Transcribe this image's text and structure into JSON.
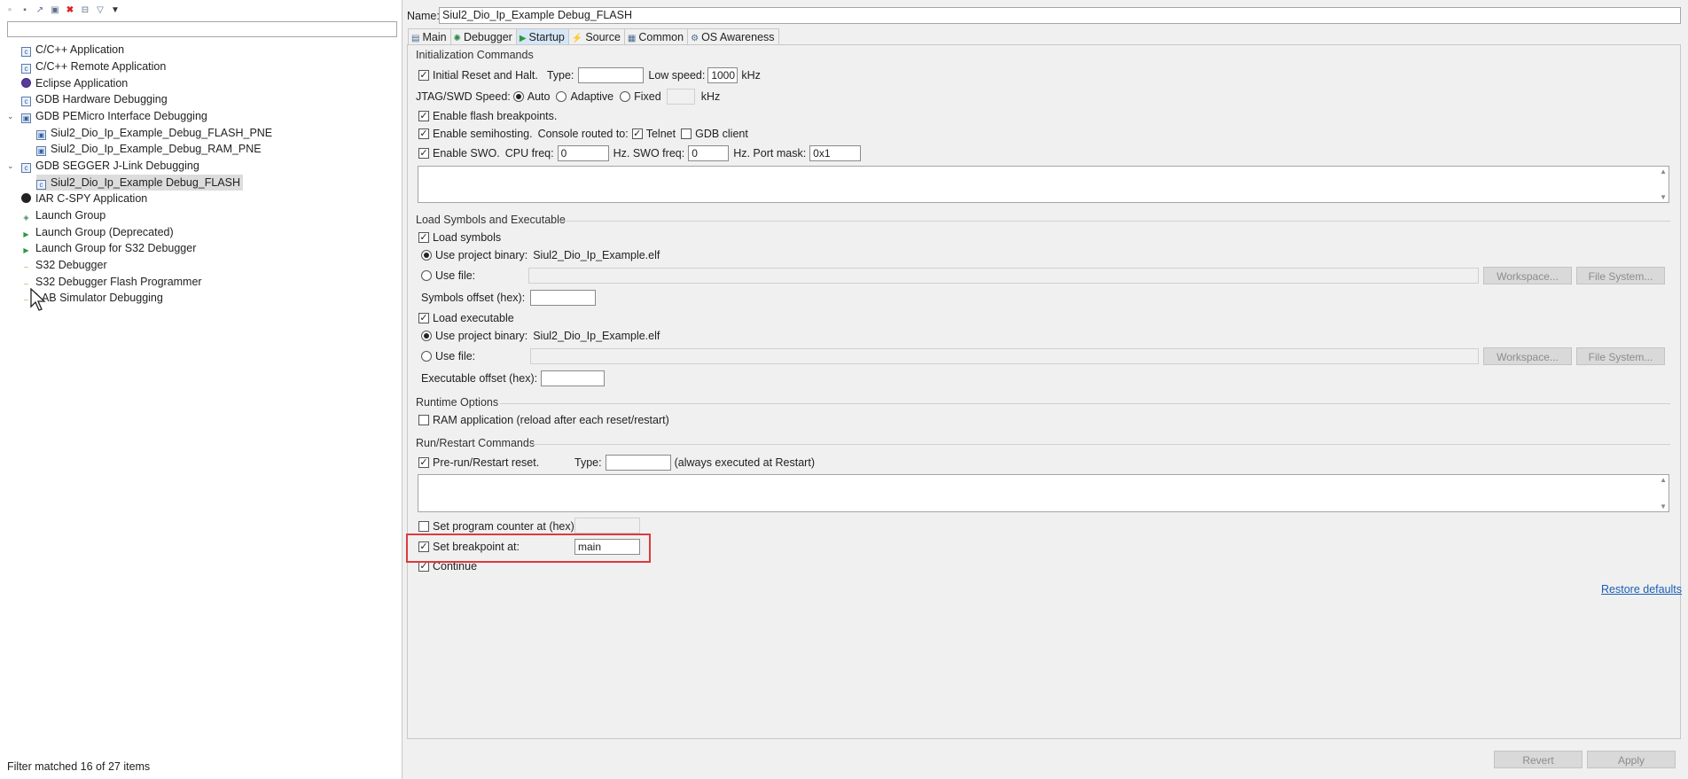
{
  "left": {
    "toolbar_icons": [
      "new-config-icon",
      "duplicate-icon",
      "export-icon",
      "import-icon",
      "delete-icon",
      "collapse-all-icon",
      "filter-icon",
      "view-menu-icon"
    ],
    "filter_placeholder": "",
    "tree": [
      {
        "label": "C/C++ Application",
        "icon": "c-app-icon"
      },
      {
        "label": "C/C++ Remote Application",
        "icon": "c-remote-icon"
      },
      {
        "label": "Eclipse Application",
        "icon": "eclipse-icon"
      },
      {
        "label": "GDB Hardware Debugging",
        "icon": "gdb-hw-icon"
      },
      {
        "label": "GDB PEMicro Interface Debugging",
        "icon": "pemicro-icon",
        "expanded": true
      },
      {
        "label": "Siul2_Dio_Ip_Example_Debug_FLASH_PNE",
        "icon": "pemicro-config-icon"
      },
      {
        "label": "Siul2_Dio_Ip_Example_Debug_RAM_PNE",
        "icon": "pemicro-config-icon"
      },
      {
        "label": "GDB SEGGER J-Link Debugging",
        "icon": "jlink-icon",
        "expanded": true
      },
      {
        "label": "Siul2_Dio_Ip_Example Debug_FLASH",
        "icon": "jlink-config-icon",
        "selected": true
      },
      {
        "label": "IAR C-SPY Application",
        "icon": "iar-icon"
      },
      {
        "label": "Launch Group",
        "icon": "launch-group-icon"
      },
      {
        "label": "Launch Group (Deprecated)",
        "icon": "launch-group-deprecated-icon"
      },
      {
        "label": "Launch Group for S32 Debugger",
        "icon": "launch-group-s32-icon"
      },
      {
        "label": "S32 Debugger",
        "icon": "s32-debugger-icon"
      },
      {
        "label": "S32 Debugger Flash Programmer",
        "icon": "s32-flash-icon"
      },
      {
        "label": "LAB Simulator Debugging",
        "icon": "simulator-icon"
      }
    ],
    "status": "Filter matched 16 of 27 items"
  },
  "right": {
    "name_label": "Name:",
    "name_value": "Siul2_Dio_Ip_Example Debug_FLASH",
    "tabs": [
      {
        "label": "Main",
        "icon": "main-tab-icon"
      },
      {
        "label": "Debugger",
        "icon": "debugger-tab-icon"
      },
      {
        "label": "Startup",
        "icon": "startup-tab-icon",
        "active": true
      },
      {
        "label": "Source",
        "icon": "source-tab-icon"
      },
      {
        "label": "Common",
        "icon": "common-tab-icon"
      },
      {
        "label": "OS Awareness",
        "icon": "os-awareness-tab-icon"
      }
    ],
    "init": {
      "title": "Initialization Commands",
      "reset_label": "Initial Reset and Halt.",
      "type_label": "Type:",
      "type_value": "",
      "low_speed_label": "Low speed:",
      "low_speed_value": "1000",
      "khz": "kHz",
      "jtag_label": "JTAG/SWD Speed:",
      "auto": "Auto",
      "adaptive": "Adaptive",
      "fixed": "Fixed",
      "fixed_value": "",
      "flash_bp": "Enable flash breakpoints.",
      "semihosting": "Enable semihosting.",
      "console_routed": "Console routed to:",
      "telnet": "Telnet",
      "gdb_client": "GDB client",
      "swo": "Enable SWO.",
      "cpu_freq_label": "CPU freq:",
      "cpu_freq_value": "0",
      "swo_freq_label": "Hz. SWO freq:",
      "swo_freq_value": "0",
      "port_mask_label": "Hz. Port mask:",
      "port_mask_value": "0x1"
    },
    "load": {
      "title": "Load Symbols and Executable",
      "load_symbols": "Load symbols",
      "use_project_binary": "Use project binary:",
      "binary_name": "Siul2_Dio_Ip_Example.elf",
      "use_file": "Use file:",
      "workspace": "Workspace...",
      "file_system": "File System...",
      "symbols_offset": "Symbols offset (hex):",
      "load_executable": "Load executable",
      "executable_offset": "Executable offset (hex):"
    },
    "runtime": {
      "title": "Runtime Options",
      "ram_app": "RAM application (reload after each reset/restart)"
    },
    "run": {
      "title": "Run/Restart Commands",
      "prerun": "Pre-run/Restart reset.",
      "type_label": "Type:",
      "type_value": "",
      "always": "(always executed at Restart)",
      "set_pc": "Set program counter at (hex):",
      "set_bp": "Set breakpoint at:",
      "bp_value": "main",
      "continue": "Continue"
    },
    "restore_defaults": "Restore defaults",
    "revert": "Revert",
    "apply": "Apply"
  }
}
